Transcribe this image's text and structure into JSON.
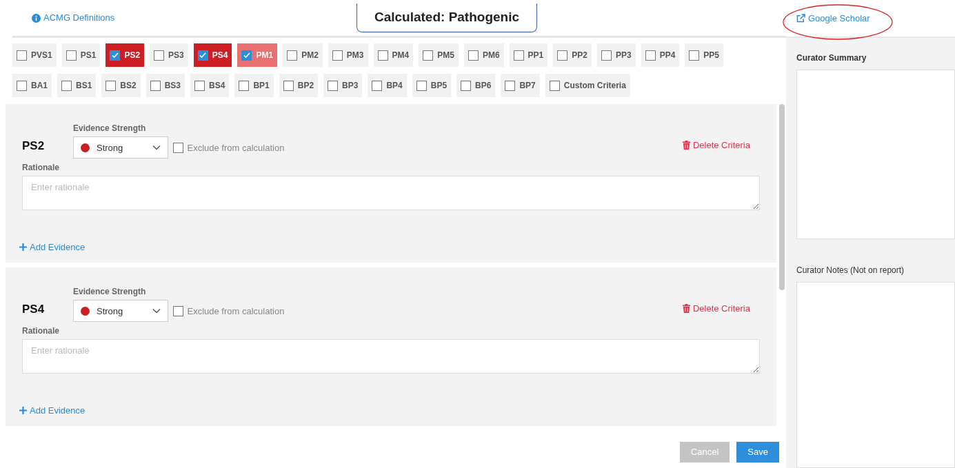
{
  "header": {
    "definitions_link": "ACMG Definitions",
    "calculated": "Calculated: Pathogenic"
  },
  "criteria_rows": [
    [
      {
        "label": "PVS1",
        "checked": false
      },
      {
        "label": "PS1",
        "checked": false
      },
      {
        "label": "PS2",
        "checked": true,
        "color": "#cc1f24"
      },
      {
        "label": "PS3",
        "checked": false
      },
      {
        "label": "PS4",
        "checked": true,
        "color": "#cc1f24"
      },
      {
        "label": "PM1",
        "checked": true,
        "color": "#e87070"
      },
      {
        "label": "PM2",
        "checked": false
      },
      {
        "label": "PM3",
        "checked": false
      },
      {
        "label": "PM4",
        "checked": false
      },
      {
        "label": "PM5",
        "checked": false
      },
      {
        "label": "PM6",
        "checked": false
      },
      {
        "label": "PP1",
        "checked": false
      },
      {
        "label": "PP2",
        "checked": false
      },
      {
        "label": "PP3",
        "checked": false
      },
      {
        "label": "PP4",
        "checked": false
      },
      {
        "label": "PP5",
        "checked": false
      }
    ],
    [
      {
        "label": "BA1",
        "checked": false
      },
      {
        "label": "BS1",
        "checked": false
      },
      {
        "label": "BS2",
        "checked": false
      },
      {
        "label": "BS3",
        "checked": false
      },
      {
        "label": "BS4",
        "checked": false
      },
      {
        "label": "BP1",
        "checked": false
      },
      {
        "label": "BP2",
        "checked": false
      },
      {
        "label": "BP3",
        "checked": false
      },
      {
        "label": "BP4",
        "checked": false
      },
      {
        "label": "BP5",
        "checked": false
      },
      {
        "label": "BP6",
        "checked": false
      },
      {
        "label": "BP7",
        "checked": false
      },
      {
        "label": "Custom Criteria",
        "checked": false
      }
    ]
  ],
  "evidence_cards": [
    {
      "title": "PS2",
      "strength_label": "Evidence Strength",
      "strength": {
        "label": "Strong",
        "color": "#cc1f24"
      },
      "exclude_label": "Exclude from calculation",
      "exclude_checked": false,
      "delete": "Delete Criteria",
      "rationale_label": "Rationale",
      "rationale_placeholder": "Enter rationale",
      "add_evidence": "Add Evidence"
    },
    {
      "title": "PS4",
      "strength_label": "Evidence Strength",
      "strength": {
        "label": "Strong",
        "color": "#cc1f24"
      },
      "exclude_label": "Exclude from calculation",
      "exclude_checked": false,
      "delete": "Delete Criteria",
      "rationale_label": "Rationale",
      "rationale_placeholder": "Enter rationale",
      "add_evidence": "Add Evidence"
    }
  ],
  "footer_buttons": [
    {
      "label": "Cancel",
      "kind": "secondary",
      "disabled": true
    },
    {
      "label": "Save",
      "kind": "primary",
      "disabled": false
    }
  ],
  "side_panel": {
    "scholar_link": "Google Scholar",
    "scholar_annotated": true,
    "summary_label": "Curator Summary",
    "notes_label": "Curator Notes (Not on report)"
  }
}
